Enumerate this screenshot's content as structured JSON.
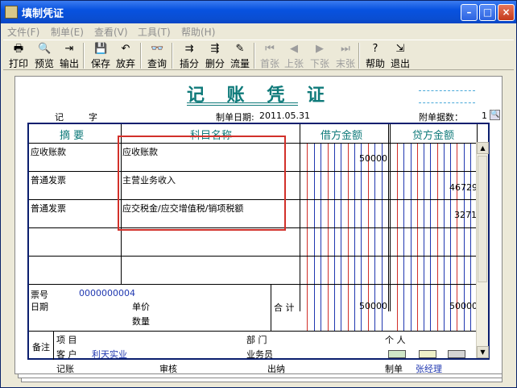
{
  "window": {
    "title": "填制凭证"
  },
  "menu": [
    "文件(F)",
    "制单(E)",
    "查看(V)",
    "工具(T)",
    "帮助(H)"
  ],
  "toolbar": [
    {
      "label": "打印",
      "icon": "printer-icon",
      "glyph": "🖶",
      "enabled": true
    },
    {
      "label": "预览",
      "icon": "preview-icon",
      "glyph": "🔍",
      "enabled": true
    },
    {
      "label": "输出",
      "icon": "export-icon",
      "glyph": "⇥",
      "enabled": true
    },
    {
      "label": "保存",
      "icon": "save-icon",
      "glyph": "💾",
      "enabled": true
    },
    {
      "label": "放弃",
      "icon": "undo-icon",
      "glyph": "↶",
      "enabled": true
    },
    {
      "label": "查询",
      "icon": "binoculars-icon",
      "glyph": "👓",
      "enabled": true
    },
    {
      "label": "插分",
      "icon": "insert-row-icon",
      "glyph": "⇉",
      "enabled": true
    },
    {
      "label": "删分",
      "icon": "delete-row-icon",
      "glyph": "⇶",
      "enabled": true
    },
    {
      "label": "流量",
      "icon": "flow-icon",
      "glyph": "✎",
      "enabled": true
    },
    {
      "label": "首张",
      "icon": "first-icon",
      "glyph": "⏮",
      "enabled": false
    },
    {
      "label": "上张",
      "icon": "prev-icon",
      "glyph": "◀",
      "enabled": false
    },
    {
      "label": "下张",
      "icon": "next-icon",
      "glyph": "▶",
      "enabled": false
    },
    {
      "label": "末张",
      "icon": "last-icon",
      "glyph": "⏭",
      "enabled": false
    },
    {
      "label": "帮助",
      "icon": "help-icon",
      "glyph": "?",
      "enabled": true
    },
    {
      "label": "退出",
      "icon": "exit-icon",
      "glyph": "⇲",
      "enabled": true
    }
  ],
  "voucher": {
    "title": "记 账 凭 证",
    "type_label": "记",
    "number_label": "字",
    "date_label": "制单日期:",
    "date": "2011.05.31",
    "attach_label": "附单据数：",
    "attach_count": "1",
    "headers": {
      "summary": "摘 要",
      "account": "科目名称",
      "debit": "借方金额",
      "credit": "贷方金额"
    },
    "rows": [
      {
        "summary": "应收账款",
        "account": "应收账款",
        "debit": "50000",
        "credit": ""
      },
      {
        "summary": "普通发票",
        "account": "主营业务收入",
        "debit": "",
        "credit": "46729"
      },
      {
        "summary": "普通发票",
        "account": "应交税金/应交增值税/销项税额",
        "debit": "",
        "credit": "3271"
      },
      {
        "summary": "",
        "account": "",
        "debit": "",
        "credit": ""
      },
      {
        "summary": "",
        "account": "",
        "debit": "",
        "credit": ""
      }
    ],
    "ticket_no_label": "票号",
    "ticket_no": "0000000004",
    "date_row_label": "日期",
    "unit_price_label": "单价",
    "quantity_label": "数量",
    "total_label": "合 计",
    "total_debit": "50000",
    "total_credit": "50000",
    "remarks_label": "备注",
    "project_label": "项  目",
    "dept_label": "部  门",
    "person_label": "个  人",
    "customer_label": "客  户",
    "customer": "利天实业",
    "salesman_label": "业务员"
  },
  "footer": {
    "bookkeeping_label": "记账",
    "audit_label": "审核",
    "cashier_label": "出纳",
    "maker_label": "制单",
    "maker": "张经理"
  },
  "colors": {
    "title_teal": "#0f7a7a",
    "grid_border": "#0a1e6e",
    "highlight_red": "#d2302a",
    "blue_text": "#1f37b0"
  }
}
